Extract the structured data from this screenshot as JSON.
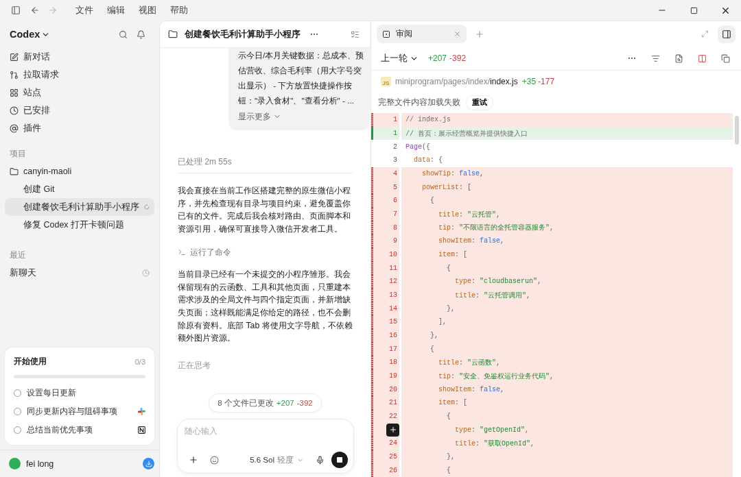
{
  "titlebar": {
    "menus": [
      "文件",
      "编辑",
      "视图",
      "帮助"
    ]
  },
  "sidebar": {
    "app_name": "Codex",
    "nav": [
      {
        "label": "新对话"
      },
      {
        "label": "拉取请求"
      },
      {
        "label": "站点"
      },
      {
        "label": "已安排"
      },
      {
        "label": "插件"
      }
    ],
    "projects_label": "项目",
    "project": {
      "name": "canyin-maoli",
      "children": [
        {
          "label": "创建 Git",
          "selected": false,
          "running": false
        },
        {
          "label": "创建餐饮毛利计算助手小程序",
          "selected": true,
          "running": true
        },
        {
          "label": "修复 Codex 打开卡顿问题",
          "selected": false,
          "running": false
        }
      ]
    },
    "recent_label": "最近",
    "recent": [
      {
        "label": "新聊天",
        "selected": false
      }
    ],
    "getting_started": {
      "title": "开始使用",
      "count": "0/3",
      "level": 0,
      "tasks": [
        {
          "label": "设置每日更新",
          "checked": false,
          "kind": "plain"
        },
        {
          "label": "同步更新内容与阻碍事项",
          "checked": false,
          "kind": "slack"
        },
        {
          "label": "总结当前优先事项",
          "checked": false,
          "kind": "notion"
        }
      ]
    },
    "user": {
      "name": "fei long"
    }
  },
  "conversation": {
    "title": "创建餐饮毛利计算助手小程序",
    "user_message": {
      "text": "示今日/本月关键数据：总成本、预估营收、综合毛利率（用大字号突出显示） - 下方放置快捷操作按钮：\"录入食材\"、\"查看分析\" - ...",
      "show_more": "显示更多"
    },
    "processed": "已处理 2m 55s",
    "messages": [
      {
        "kind": "text",
        "text": "我会直接在当前工作区搭建完整的原生微信小程序，并先检查现有目录与项目约束，避免覆盖你已有的文件。完成后我会核对路由、页面脚本和资源引用，确保可直接导入微信开发者工具。"
      },
      {
        "kind": "command",
        "text": "运行了命令"
      },
      {
        "kind": "text",
        "text": "当前目录已经有一个未提交的小程序雏形。我会保留现有的云函数、工具和其他页面，只重建本需求涉及的全局文件与四个指定页面，并新增缺失页面；这样既能满足你给定的路径，也不会删除原有资料。底部 Tab 将使用文字导航，不依赖额外图片资源。"
      },
      {
        "kind": "status",
        "text": "正在思考"
      }
    ],
    "changes": {
      "label": "8 个文件已更改",
      "added": "+207",
      "removed": "-392"
    },
    "composer": {
      "placeholder": "随心输入",
      "model": "5.6 Sol",
      "effort": "轻度"
    }
  },
  "review": {
    "tabs": [
      {
        "label": "审阅",
        "selected": true
      }
    ],
    "round": "上一轮",
    "added": "+207",
    "removed": "-392",
    "file": {
      "badge": "JS",
      "dir": "miniprogram/pages/index/",
      "name": "index.js",
      "added": "+35",
      "removed": "-177"
    },
    "load_error": "完整文件内容加载失败",
    "retry": "重试",
    "lines": [
      {
        "number": "1",
        "kind": "removed",
        "tokens": [
          {
            "kind": "comment",
            "text": "// index.js"
          }
        ]
      },
      {
        "number": "1",
        "kind": "added",
        "tokens": [
          {
            "kind": "comment",
            "text": "// 首页：展示经营概览并提供快捷入口"
          }
        ]
      },
      {
        "number": "2",
        "kind": "context",
        "tokens": [
          {
            "kind": "ident",
            "text": "Page"
          },
          {
            "kind": "punct",
            "text": "({"
          }
        ]
      },
      {
        "number": "3",
        "kind": "context",
        "tokens": [
          {
            "kind": "key",
            "text": "  data"
          },
          {
            "kind": "punct",
            "text": ": {"
          }
        ]
      },
      {
        "number": "4",
        "kind": "removed",
        "tokens": [
          {
            "kind": "key",
            "text": "    showTip"
          },
          {
            "kind": "punct",
            "text": ": "
          },
          {
            "kind": "bool",
            "text": "false"
          },
          {
            "kind": "punct",
            "text": ","
          }
        ]
      },
      {
        "number": "5",
        "kind": "removed",
        "tokens": [
          {
            "kind": "key",
            "text": "    powerList"
          },
          {
            "kind": "punct",
            "text": ": ["
          }
        ]
      },
      {
        "number": "6",
        "kind": "removed",
        "tokens": [
          {
            "kind": "punct",
            "text": "      {"
          }
        ]
      },
      {
        "number": "7",
        "kind": "removed",
        "tokens": [
          {
            "kind": "key",
            "text": "        title"
          },
          {
            "kind": "punct",
            "text": ": "
          },
          {
            "kind": "string",
            "text": "\"云托管\""
          },
          {
            "kind": "punct",
            "text": ","
          }
        ]
      },
      {
        "number": "8",
        "kind": "removed",
        "tokens": [
          {
            "kind": "key",
            "text": "        tip"
          },
          {
            "kind": "punct",
            "text": ": "
          },
          {
            "kind": "string",
            "text": "\"不限语言的全托管容器服务\""
          },
          {
            "kind": "punct",
            "text": ","
          }
        ]
      },
      {
        "number": "9",
        "kind": "removed",
        "tokens": [
          {
            "kind": "key",
            "text": "        showItem"
          },
          {
            "kind": "punct",
            "text": ": "
          },
          {
            "kind": "bool",
            "text": "false"
          },
          {
            "kind": "punct",
            "text": ","
          }
        ]
      },
      {
        "number": "10",
        "kind": "removed",
        "tokens": [
          {
            "kind": "key",
            "text": "        item"
          },
          {
            "kind": "punct",
            "text": ": ["
          }
        ]
      },
      {
        "number": "11",
        "kind": "removed",
        "tokens": [
          {
            "kind": "punct",
            "text": "          {"
          }
        ]
      },
      {
        "number": "12",
        "kind": "removed",
        "tokens": [
          {
            "kind": "key",
            "text": "            type"
          },
          {
            "kind": "punct",
            "text": ": "
          },
          {
            "kind": "string",
            "text": "\"cloudbaserun\""
          },
          {
            "kind": "punct",
            "text": ","
          }
        ]
      },
      {
        "number": "13",
        "kind": "removed",
        "tokens": [
          {
            "kind": "key",
            "text": "            title"
          },
          {
            "kind": "punct",
            "text": ": "
          },
          {
            "kind": "string",
            "text": "\"云托管调用\""
          },
          {
            "kind": "punct",
            "text": ","
          }
        ]
      },
      {
        "number": "14",
        "kind": "removed",
        "tokens": [
          {
            "kind": "punct",
            "text": "          },"
          }
        ]
      },
      {
        "number": "15",
        "kind": "removed",
        "tokens": [
          {
            "kind": "punct",
            "text": "        ],"
          }
        ]
      },
      {
        "number": "16",
        "kind": "removed",
        "tokens": [
          {
            "kind": "punct",
            "text": "      },"
          }
        ]
      },
      {
        "number": "17",
        "kind": "removed",
        "tokens": [
          {
            "kind": "punct",
            "text": "      {"
          }
        ]
      },
      {
        "number": "18",
        "kind": "removed",
        "tokens": [
          {
            "kind": "key",
            "text": "        title"
          },
          {
            "kind": "punct",
            "text": ": "
          },
          {
            "kind": "string",
            "text": "\"云函数\""
          },
          {
            "kind": "punct",
            "text": ","
          }
        ]
      },
      {
        "number": "19",
        "kind": "removed",
        "tokens": [
          {
            "kind": "key",
            "text": "        tip"
          },
          {
            "kind": "punct",
            "text": ": "
          },
          {
            "kind": "string",
            "text": "\"安全、免鉴权运行业务代码\""
          },
          {
            "kind": "punct",
            "text": ","
          }
        ]
      },
      {
        "number": "20",
        "kind": "removed",
        "tokens": [
          {
            "kind": "key",
            "text": "        showItem"
          },
          {
            "kind": "punct",
            "text": ": "
          },
          {
            "kind": "bool",
            "text": "false"
          },
          {
            "kind": "punct",
            "text": ","
          }
        ]
      },
      {
        "number": "21",
        "kind": "removed",
        "tokens": [
          {
            "kind": "key",
            "text": "        item"
          },
          {
            "kind": "punct",
            "text": ": ["
          }
        ]
      },
      {
        "number": "22",
        "kind": "removed",
        "tokens": [
          {
            "kind": "punct",
            "text": "          {"
          }
        ]
      },
      {
        "kind": "removed",
        "hover_add": true,
        "tokens": [
          {
            "kind": "key",
            "text": "            type"
          },
          {
            "kind": "punct",
            "text": ": "
          },
          {
            "kind": "string",
            "text": "\"getOpenId\""
          },
          {
            "kind": "punct",
            "text": ","
          }
        ]
      },
      {
        "number": "24",
        "kind": "removed",
        "tokens": [
          {
            "kind": "key",
            "text": "            title"
          },
          {
            "kind": "punct",
            "text": ": "
          },
          {
            "kind": "string",
            "text": "\"获取OpenId\""
          },
          {
            "kind": "punct",
            "text": ","
          }
        ]
      },
      {
        "number": "25",
        "kind": "removed",
        "tokens": [
          {
            "kind": "punct",
            "text": "          },"
          }
        ]
      },
      {
        "number": "26",
        "kind": "removed",
        "tokens": [
          {
            "kind": "punct",
            "text": "          {"
          }
        ]
      }
    ]
  }
}
